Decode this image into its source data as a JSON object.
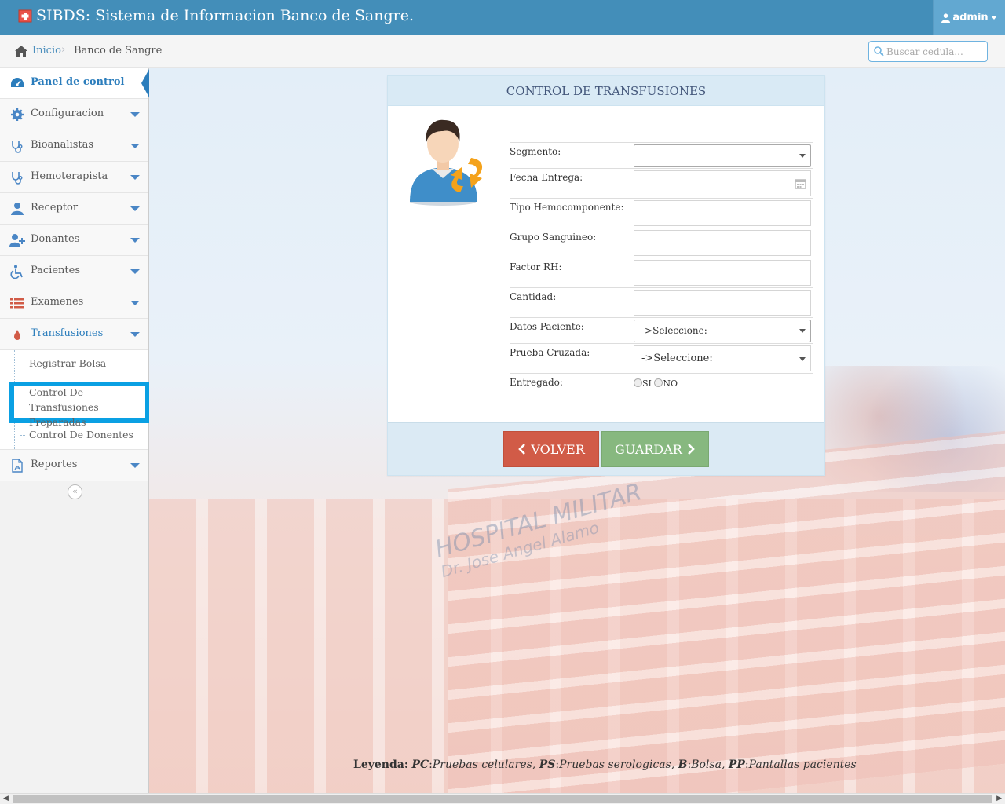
{
  "app": {
    "title": "SIBDS: Sistema de Informacion Banco de Sangre.",
    "user": "admin"
  },
  "breadcrumb": {
    "home": "Inicio",
    "separator": "›",
    "current": "Banco de Sangre"
  },
  "search": {
    "placeholder": "Buscar cedula..."
  },
  "sidebar": {
    "items": [
      {
        "label": "Panel de control",
        "icon": "dashboard-icon"
      },
      {
        "label": "Configuracion",
        "icon": "gear-icon"
      },
      {
        "label": "Bioanalistas",
        "icon": "stethoscope-icon"
      },
      {
        "label": "Hemoterapista",
        "icon": "stethoscope-icon"
      },
      {
        "label": "Receptor",
        "icon": "user-icon"
      },
      {
        "label": "Donantes",
        "icon": "user-plus-icon"
      },
      {
        "label": "Pacientes",
        "icon": "wheelchair-icon"
      },
      {
        "label": "Examenes",
        "icon": "list-icon"
      },
      {
        "label": "Transfusiones",
        "icon": "blood-drop-icon"
      },
      {
        "label": "Reportes",
        "icon": "pdf-file-icon"
      }
    ],
    "submenu": [
      {
        "label": "Registrar Bolsa"
      },
      {
        "label": "Control De Transfusiones Preparadas"
      },
      {
        "label": "Control De Donentes"
      }
    ],
    "collapse": "«"
  },
  "form": {
    "title": "CONTROL DE TRANSFUSIONES",
    "fields": {
      "segmento": "Segmento:",
      "fecha_entrega": "Fecha Entrega:",
      "tipo_hemocomponente": "Tipo Hemocomponente:",
      "grupo_sanguineo": "Grupo Sanguineo:",
      "factor_rh": "Factor RH:",
      "cantidad": "Cantidad:",
      "datos_paciente": "Datos Paciente:",
      "prueba_cruzada": "Prueba Cruzada:",
      "entregado": "Entregado:"
    },
    "datos_paciente_value": "->Seleccione:",
    "prueba_cruzada_value": "->Seleccione:",
    "radio_si": "SI",
    "radio_no": "NO",
    "btn_volver": "VOLVER",
    "btn_guardar": "GUARDAR"
  },
  "background": {
    "hospital_line1": "HOSPITAL MILITAR",
    "hospital_line2": "Dr. Jose Angel Alamo"
  },
  "legend": {
    "label": "Leyenda:",
    "items": [
      {
        "key": "PC",
        "text": "Pruebas celulares,"
      },
      {
        "key": "PS",
        "text": "Pruebas serologicas,"
      },
      {
        "key": "B",
        "text": "Bolsa,"
      },
      {
        "key": "PP",
        "text": "Pantallas pacientes"
      }
    ]
  },
  "colors": {
    "navbar": "#438eb9",
    "accent": "#2b7dbc",
    "highlight": "#0aa0e3",
    "danger": "#d15b47",
    "success": "#87b87f"
  }
}
